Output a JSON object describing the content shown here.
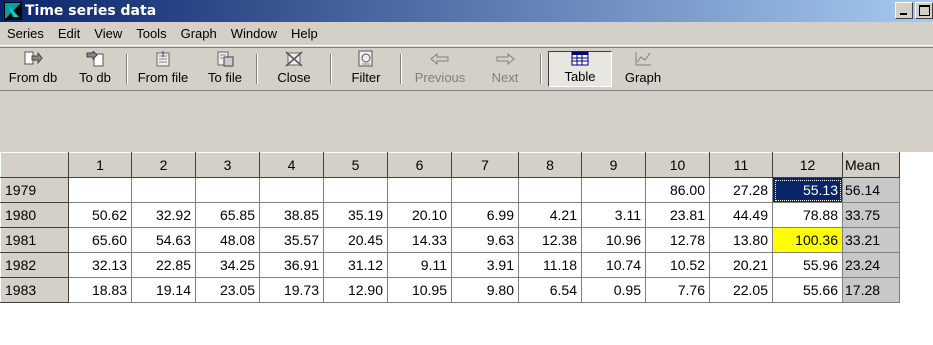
{
  "window": {
    "title": "Time series data"
  },
  "menu": [
    "Series",
    "Edit",
    "View",
    "Tools",
    "Graph",
    "Window",
    "Help"
  ],
  "toolbar": {
    "from_db": "From db",
    "to_db": "To db",
    "from_file": "From file",
    "to_file": "To file",
    "close": "Close",
    "filter": "Filter",
    "previous": "Previous",
    "next": "Next",
    "table": "Table",
    "graph": "Graph"
  },
  "table": {
    "columns": [
      "",
      "1",
      "2",
      "3",
      "4",
      "5",
      "6",
      "7",
      "8",
      "9",
      "10",
      "11",
      "12",
      "Mean"
    ],
    "rows": [
      {
        "year": "1979",
        "cells": [
          "",
          "",
          "",
          "",
          "",
          "",
          "",
          "",
          "",
          "86.00",
          "27.28",
          "55.13"
        ],
        "mean": "56.14"
      },
      {
        "year": "1980",
        "cells": [
          "50.62",
          "32.92",
          "65.85",
          "38.85",
          "35.19",
          "20.10",
          "6.99",
          "4.21",
          "3.11",
          "23.81",
          "44.49",
          "78.88"
        ],
        "mean": "33.75"
      },
      {
        "year": "1981",
        "cells": [
          "65.60",
          "54.63",
          "48.08",
          "35.57",
          "20.45",
          "14.33",
          "9.63",
          "12.38",
          "10.96",
          "12.78",
          "13.80",
          "100.36"
        ],
        "mean": "33.21"
      },
      {
        "year": "1982",
        "cells": [
          "32.13",
          "22.85",
          "34.25",
          "36.91",
          "31.12",
          "9.11",
          "3.91",
          "11.18",
          "10.74",
          "10.52",
          "20.21",
          "55.96"
        ],
        "mean": "23.24"
      },
      {
        "year": "1983",
        "cells": [
          "18.83",
          "19.14",
          "23.05",
          "19.73",
          "12.90",
          "10.95",
          "9.80",
          "6.54",
          "0.95",
          "7.76",
          "22.05",
          "55.66"
        ],
        "mean": "17.28"
      }
    ]
  }
}
